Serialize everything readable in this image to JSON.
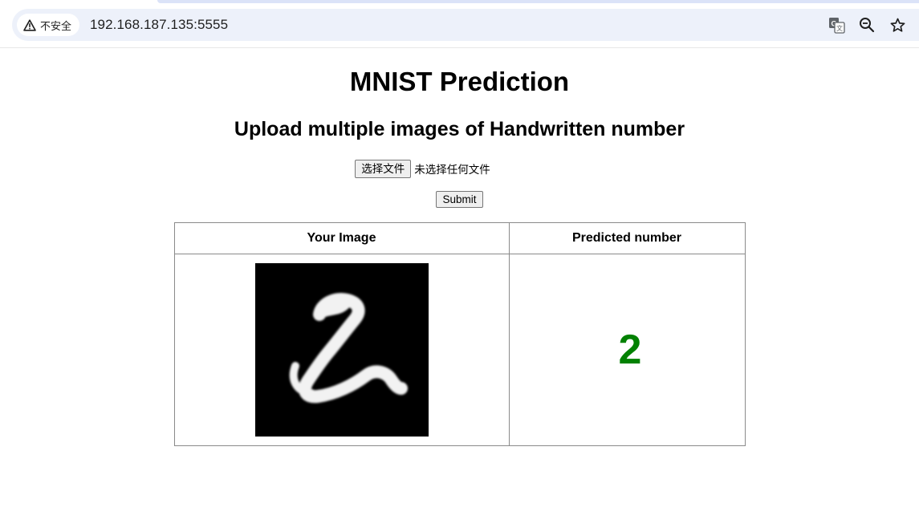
{
  "browser": {
    "security_label": "不安全",
    "url": "192.168.187.135:5555",
    "icons": [
      "warning-icon",
      "translate-icon",
      "zoom-icon",
      "bookmark-star-icon"
    ]
  },
  "page": {
    "title": "MNIST Prediction",
    "subtitle": "Upload multiple images of Handwritten number"
  },
  "form": {
    "file_button_label": "选择文件",
    "file_status": "未选择任何文件",
    "submit_label": "Submit"
  },
  "results": {
    "headers": [
      "Your Image",
      "Predicted number"
    ],
    "rows": [
      {
        "image": "handwritten-digit-image",
        "prediction": "2"
      }
    ],
    "prediction_color": "#028102"
  }
}
